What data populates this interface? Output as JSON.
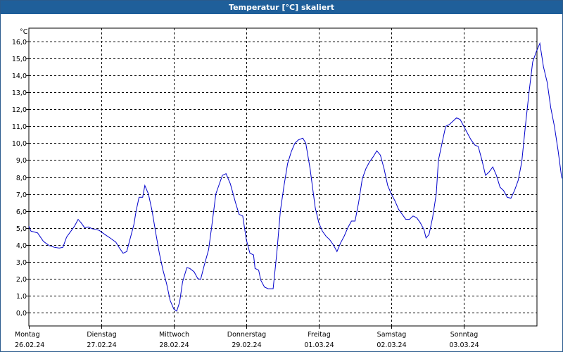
{
  "window": {
    "title": "Temperatur [°C] skaliert"
  },
  "chart_data": {
    "type": "line",
    "title": "Temperatur [°C] skaliert",
    "ylabel": "°C",
    "ylim": [
      -0.8,
      16.8
    ],
    "yticks": [
      0,
      1,
      2,
      3,
      4,
      5,
      6,
      7,
      8,
      9,
      10,
      11,
      12,
      13,
      14,
      15,
      16
    ],
    "ytick_labels": [
      "0,0",
      "1,0",
      "2,0",
      "3,0",
      "4,0",
      "5,0",
      "6,0",
      "7,0",
      "8,0",
      "9,0",
      "10,0",
      "11,0",
      "12,0",
      "13,0",
      "14,0",
      "15,0",
      "16,0"
    ],
    "xlim_days": [
      0,
      7.03
    ],
    "days": [
      {
        "weekday": "Montag",
        "date": "26.02.24"
      },
      {
        "weekday": "Dienstag",
        "date": "27.02.24"
      },
      {
        "weekday": "Mittwoch",
        "date": "28.02.24"
      },
      {
        "weekday": "Donnerstag",
        "date": "29.02.24"
      },
      {
        "weekday": "Freitag",
        "date": "01.03.24"
      },
      {
        "weekday": "Samstag",
        "date": "02.03.24"
      },
      {
        "weekday": "Sonntag",
        "date": "03.03.24"
      }
    ],
    "grid": true,
    "series": [
      {
        "color": "#0000cc",
        "points": [
          [
            0.0,
            5.1
          ],
          [
            0.03,
            4.8
          ],
          [
            0.12,
            4.7
          ],
          [
            0.2,
            4.2
          ],
          [
            0.28,
            3.95
          ],
          [
            0.35,
            3.85
          ],
          [
            0.42,
            3.8
          ],
          [
            0.47,
            3.85
          ],
          [
            0.52,
            4.45
          ],
          [
            0.58,
            4.8
          ],
          [
            0.63,
            5.1
          ],
          [
            0.68,
            5.5
          ],
          [
            0.72,
            5.3
          ],
          [
            0.77,
            5.0
          ],
          [
            0.82,
            5.05
          ],
          [
            0.87,
            4.95
          ],
          [
            0.97,
            4.85
          ],
          [
            1.05,
            4.6
          ],
          [
            1.12,
            4.4
          ],
          [
            1.2,
            4.15
          ],
          [
            1.25,
            3.8
          ],
          [
            1.3,
            3.5
          ],
          [
            1.35,
            3.6
          ],
          [
            1.4,
            4.4
          ],
          [
            1.45,
            5.2
          ],
          [
            1.48,
            6.0
          ],
          [
            1.52,
            6.8
          ],
          [
            1.57,
            6.8
          ],
          [
            1.6,
            7.5
          ],
          [
            1.65,
            7.0
          ],
          [
            1.7,
            6.0
          ],
          [
            1.75,
            4.7
          ],
          [
            1.8,
            3.5
          ],
          [
            1.85,
            2.5
          ],
          [
            1.9,
            1.7
          ],
          [
            1.95,
            0.7
          ],
          [
            2.0,
            0.2
          ],
          [
            2.04,
            0.08
          ],
          [
            2.08,
            0.6
          ],
          [
            2.12,
            1.8
          ],
          [
            2.18,
            2.65
          ],
          [
            2.22,
            2.6
          ],
          [
            2.28,
            2.4
          ],
          [
            2.33,
            2.0
          ],
          [
            2.37,
            1.95
          ],
          [
            2.42,
            2.8
          ],
          [
            2.48,
            3.7
          ],
          [
            2.52,
            5.0
          ],
          [
            2.58,
            7.0
          ],
          [
            2.62,
            7.5
          ],
          [
            2.67,
            8.1
          ],
          [
            2.72,
            8.2
          ],
          [
            2.78,
            7.6
          ],
          [
            2.85,
            6.5
          ],
          [
            2.9,
            5.8
          ],
          [
            2.95,
            5.7
          ],
          [
            3.0,
            4.3
          ],
          [
            3.05,
            3.5
          ],
          [
            3.1,
            3.4
          ],
          [
            3.12,
            2.6
          ],
          [
            3.17,
            2.5
          ],
          [
            3.2,
            1.9
          ],
          [
            3.25,
            1.5
          ],
          [
            3.3,
            1.4
          ],
          [
            3.37,
            1.4
          ],
          [
            3.42,
            3.5
          ],
          [
            3.47,
            6.0
          ],
          [
            3.52,
            7.5
          ],
          [
            3.57,
            8.8
          ],
          [
            3.62,
            9.5
          ],
          [
            3.67,
            10.0
          ],
          [
            3.72,
            10.2
          ],
          [
            3.78,
            10.3
          ],
          [
            3.82,
            10.0
          ],
          [
            3.88,
            8.5
          ],
          [
            3.95,
            6.2
          ],
          [
            4.0,
            5.3
          ],
          [
            4.05,
            4.8
          ],
          [
            4.1,
            4.5
          ],
          [
            4.15,
            4.3
          ],
          [
            4.2,
            4.0
          ],
          [
            4.25,
            3.6
          ],
          [
            4.3,
            4.1
          ],
          [
            4.35,
            4.5
          ],
          [
            4.4,
            5.0
          ],
          [
            4.45,
            5.4
          ],
          [
            4.5,
            5.4
          ],
          [
            4.55,
            6.5
          ],
          [
            4.6,
            7.9
          ],
          [
            4.65,
            8.5
          ],
          [
            4.7,
            8.9
          ],
          [
            4.75,
            9.2
          ],
          [
            4.8,
            9.55
          ],
          [
            4.85,
            9.3
          ],
          [
            4.9,
            8.5
          ],
          [
            4.95,
            7.5
          ],
          [
            5.0,
            7.0
          ],
          [
            5.05,
            6.6
          ],
          [
            5.1,
            6.1
          ],
          [
            5.15,
            5.8
          ],
          [
            5.2,
            5.5
          ],
          [
            5.25,
            5.5
          ],
          [
            5.3,
            5.7
          ],
          [
            5.35,
            5.6
          ],
          [
            5.4,
            5.3
          ],
          [
            5.45,
            4.9
          ],
          [
            5.48,
            4.4
          ],
          [
            5.52,
            4.6
          ],
          [
            5.57,
            5.6
          ],
          [
            5.62,
            7.0
          ],
          [
            5.65,
            9.0
          ],
          [
            5.7,
            10.0
          ],
          [
            5.75,
            11.0
          ],
          [
            5.8,
            11.1
          ],
          [
            5.85,
            11.3
          ],
          [
            5.9,
            11.5
          ],
          [
            5.95,
            11.4
          ],
          [
            6.0,
            11.0
          ],
          [
            6.05,
            10.6
          ],
          [
            6.1,
            10.2
          ],
          [
            6.15,
            9.9
          ],
          [
            6.2,
            9.8
          ],
          [
            6.25,
            9.0
          ],
          [
            6.3,
            8.1
          ],
          [
            6.35,
            8.3
          ],
          [
            6.4,
            8.6
          ],
          [
            6.45,
            8.1
          ],
          [
            6.5,
            7.4
          ],
          [
            6.55,
            7.2
          ],
          [
            6.6,
            6.8
          ],
          [
            6.65,
            6.75
          ],
          [
            6.7,
            7.2
          ],
          [
            6.75,
            7.8
          ],
          [
            6.8,
            8.9
          ],
          [
            6.85,
            11.0
          ],
          [
            6.9,
            13.0
          ],
          [
            6.95,
            14.8
          ],
          [
            7.0,
            15.4
          ],
          [
            7.05,
            15.9
          ],
          [
            7.1,
            14.5
          ],
          [
            7.15,
            13.6
          ],
          [
            7.2,
            12.1
          ],
          [
            7.25,
            11.0
          ],
          [
            7.3,
            9.6
          ],
          [
            7.35,
            8.0
          ],
          [
            7.4,
            7.6
          ],
          [
            7.45,
            7.5
          ]
        ]
      }
    ]
  }
}
